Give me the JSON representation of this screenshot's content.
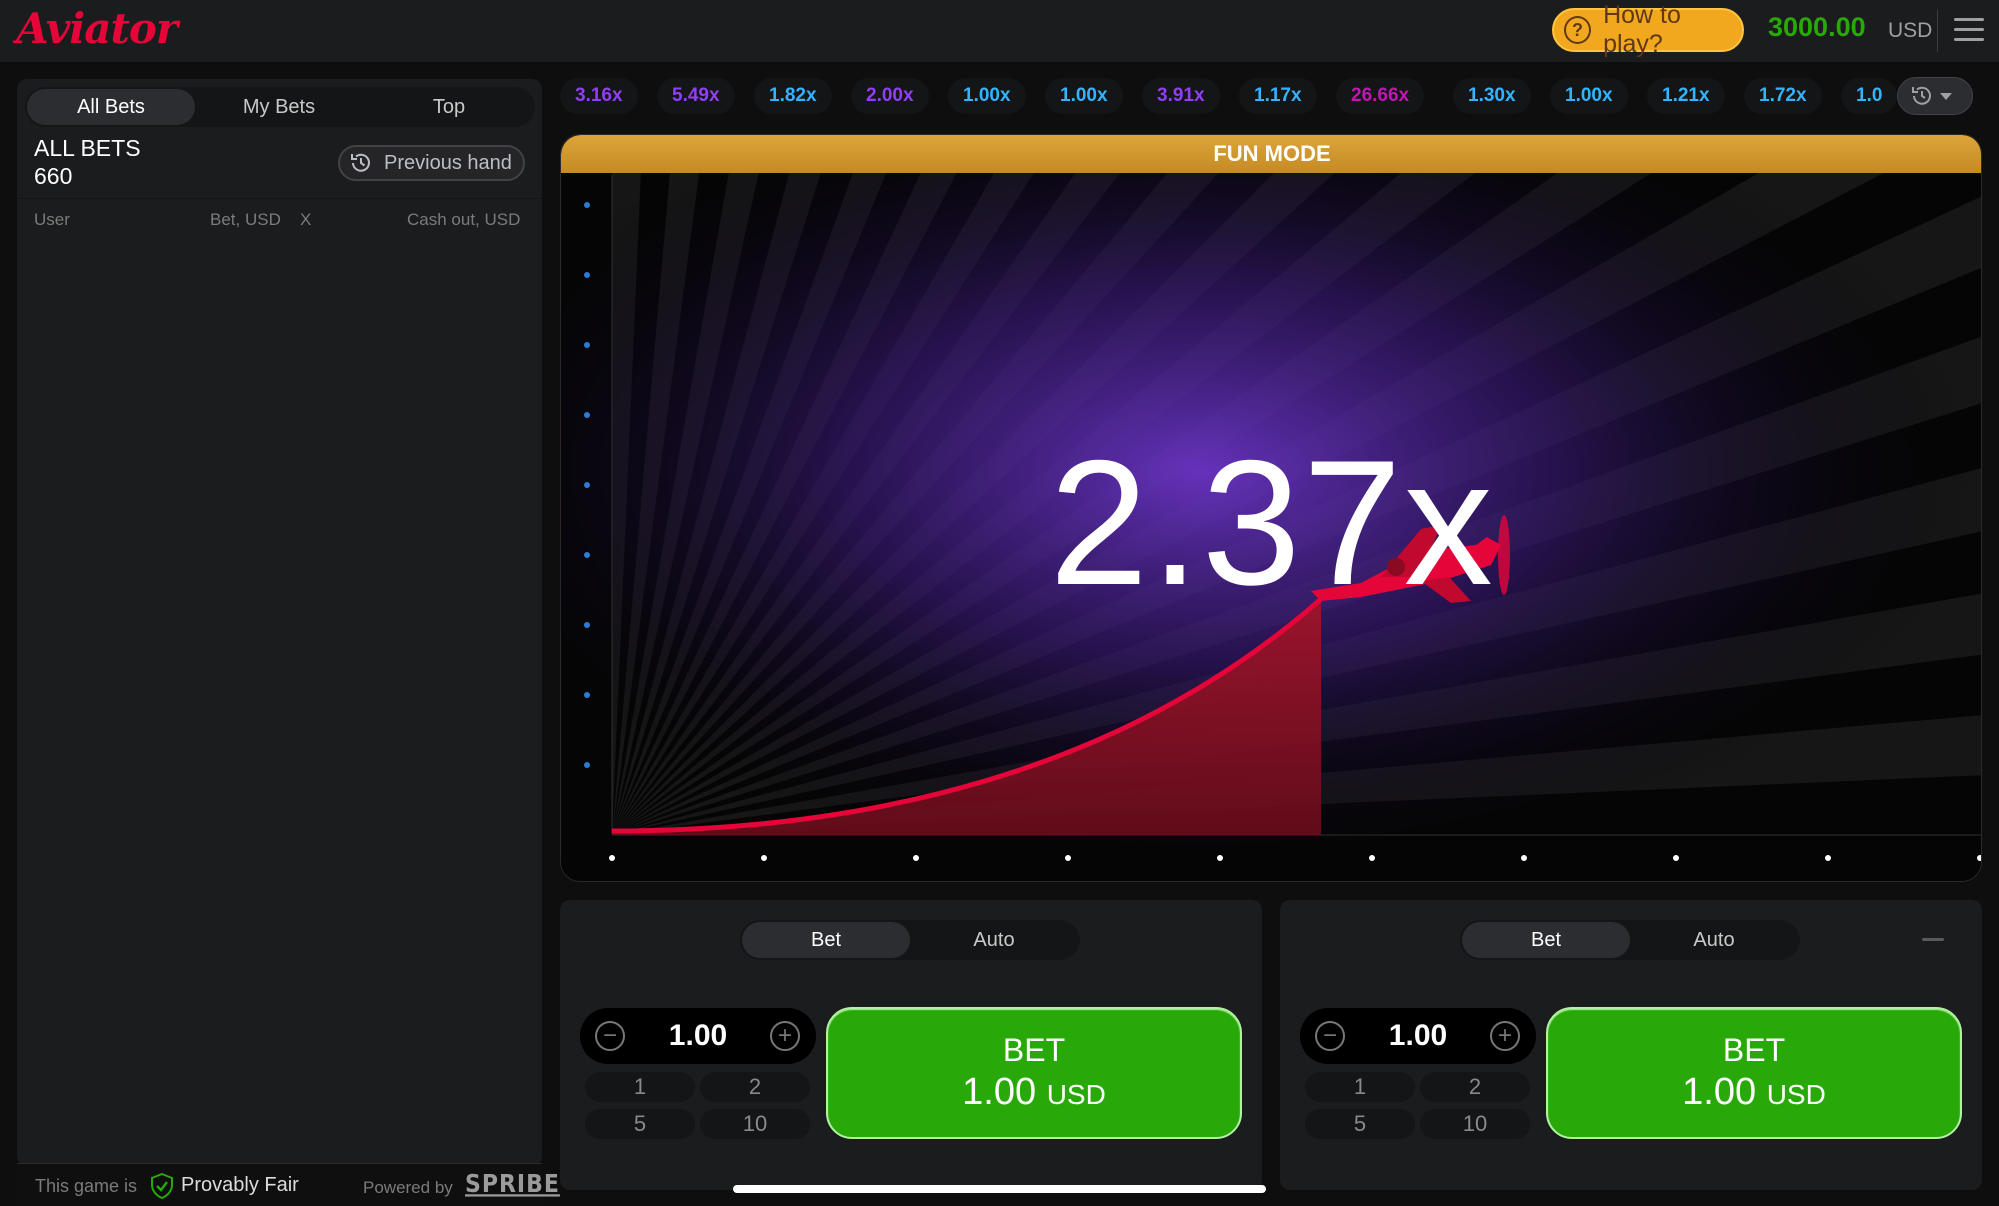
{
  "header": {
    "logo": "Aviator",
    "how_to_play": "How to play?",
    "balance": "3000.00",
    "currency": "USD"
  },
  "left_panel": {
    "tabs": [
      "All Bets",
      "My Bets",
      "Top"
    ],
    "title": "ALL BETS",
    "count": "660",
    "previous_hand": "Previous hand",
    "columns": {
      "user": "User",
      "bet": "Bet, USD",
      "x": "X",
      "cashout": "Cash out, USD"
    }
  },
  "footer": {
    "prefix": "This game is",
    "provably_fair": "Provably Fair",
    "powered_by": "Powered by",
    "brand": "SPRIBE"
  },
  "history": [
    {
      "value": "3.16x",
      "color": "#913ef8"
    },
    {
      "value": "5.49x",
      "color": "#913ef8"
    },
    {
      "value": "1.82x",
      "color": "#34b4ff"
    },
    {
      "value": "2.00x",
      "color": "#913ef8"
    },
    {
      "value": "1.00x",
      "color": "#34b4ff"
    },
    {
      "value": "1.00x",
      "color": "#34b4ff"
    },
    {
      "value": "3.91x",
      "color": "#913ef8"
    },
    {
      "value": "1.17x",
      "color": "#34b4ff"
    },
    {
      "value": "26.66x",
      "color": "#c017b4"
    },
    {
      "value": "1.30x",
      "color": "#34b4ff"
    },
    {
      "value": "1.00x",
      "color": "#34b4ff"
    },
    {
      "value": "1.21x",
      "color": "#34b4ff"
    },
    {
      "value": "1.72x",
      "color": "#34b4ff"
    },
    {
      "value": "1.0",
      "color": "#34b4ff"
    }
  ],
  "game": {
    "banner": "FUN MODE",
    "multiplier": "2.37x"
  },
  "bet_panels": [
    {
      "tabs": [
        "Bet",
        "Auto"
      ],
      "amount": "1.00",
      "quick": [
        "1",
        "2",
        "5",
        "10"
      ],
      "bet_label": "BET",
      "bet_amount": "1.00",
      "bet_currency": "USD"
    },
    {
      "tabs": [
        "Bet",
        "Auto"
      ],
      "amount": "1.00",
      "quick": [
        "1",
        "2",
        "5",
        "10"
      ],
      "bet_label": "BET",
      "bet_amount": "1.00",
      "bet_currency": "USD"
    }
  ]
}
